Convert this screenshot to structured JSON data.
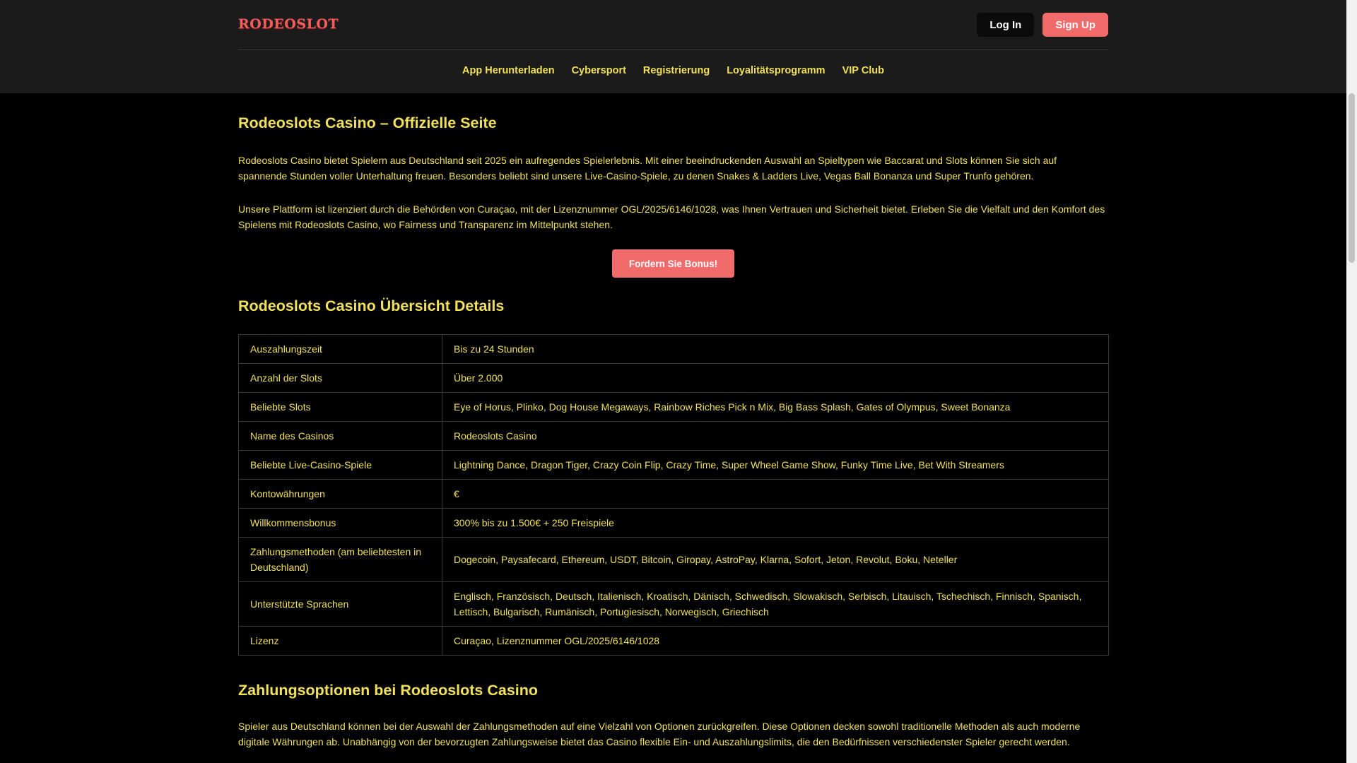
{
  "header": {
    "logo_text": "RODEOSLOT",
    "login_label": "Log In",
    "signup_label": "Sign Up",
    "nav": [
      "App Herunterladen",
      "Cybersport",
      "Registrierung",
      "Loyalitätsprogramm",
      "VIP Club"
    ]
  },
  "main": {
    "title": "Rodeoslots Casino – Offizielle Seite",
    "intro_1": "Rodeoslots Casino bietet Spielern aus Deutschland seit 2025 ein aufregendes Spielerlebnis. Mit einer beeindruckenden Auswahl an Spieltypen wie Baccarat und Slots können Sie sich auf spannende Stunden voller Unterhaltung freuen. Besonders beliebt sind unsere Live-Casino-Spiele, zu denen Snakes & Ladders Live, Vegas Ball Bonanza und Super Trunfo gehören.",
    "intro_2": "Unsere Plattform ist lizenziert durch die Behörden von Curaçao, mit der Lizenznummer OGL/2025/6146/1028, was Ihnen Vertrauen und Sicherheit bietet. Erleben Sie die Vielfalt und den Komfort des Spielens mit Rodeoslots Casino, wo Fairness und Transparenz im Mittelpunkt stehen.",
    "cta_label": "Fordern Sie Bonus!",
    "overview_title": "Rodeoslots Casino Übersicht Details",
    "overview_rows": [
      {
        "key": "Auszahlungszeit",
        "value": "Bis zu 24 Stunden"
      },
      {
        "key": "Anzahl der Slots",
        "value": "Über 2.000"
      },
      {
        "key": "Beliebte Slots",
        "value": "Eye of Horus, Plinko, Dog House Megaways, Rainbow Riches Pick n Mix, Big Bass Splash, Gates of Olympus, Sweet Bonanza"
      },
      {
        "key": "Name des Casinos",
        "value": "Rodeoslots Casino"
      },
      {
        "key": "Beliebte Live-Casino-Spiele",
        "value": "Lightning Dance, Dragon Tiger, Crazy Coin Flip, Crazy Time, Super Wheel Game Show, Funky Time Live, Bet With Streamers"
      },
      {
        "key": "Kontowährungen",
        "value": "€"
      },
      {
        "key": "Willkommensbonus",
        "value": "300% bis zu 1.500€ + 250 Freispiele"
      },
      {
        "key": "Zahlungsmethoden (am beliebtesten in Deutschland)",
        "value": "Dogecoin, Paysafecard, Ethereum, USDT, Bitcoin, Giropay, AstroPay, Klarna, Sofort, Jeton, Revolut, Boku, Neteller"
      },
      {
        "key": "Unterstützte Sprachen",
        "value": "Englisch, Französisch, Deutsch, Italienisch, Kroatisch, Dänisch, Schwedisch, Slowakisch, Serbisch, Litauisch, Tschechisch, Finnisch, Spanisch, Lettisch, Bulgarisch, Rumänisch, Portugiesisch, Norwegisch, Griechisch"
      },
      {
        "key": "Lizenz",
        "value": "Curaçao, Lizenznummer OGL/2025/6146/1028"
      }
    ],
    "payments_title": "Zahlungsoptionen bei Rodeoslots Casino",
    "payments_text": "Spieler aus Deutschland können bei der Auswahl der Zahlungsmethoden auf eine Vielzahl von Optionen zurückgreifen. Diese Optionen decken sowohl traditionelle Methoden als auch moderne digitale Währungen ab. Unabhängig von der bevorzugten Zahlungsweise bietet das Casino flexible Ein- und Auszahlungslimits, die den Bedürfnissen verschiedenster Spieler gerecht werden."
  }
}
